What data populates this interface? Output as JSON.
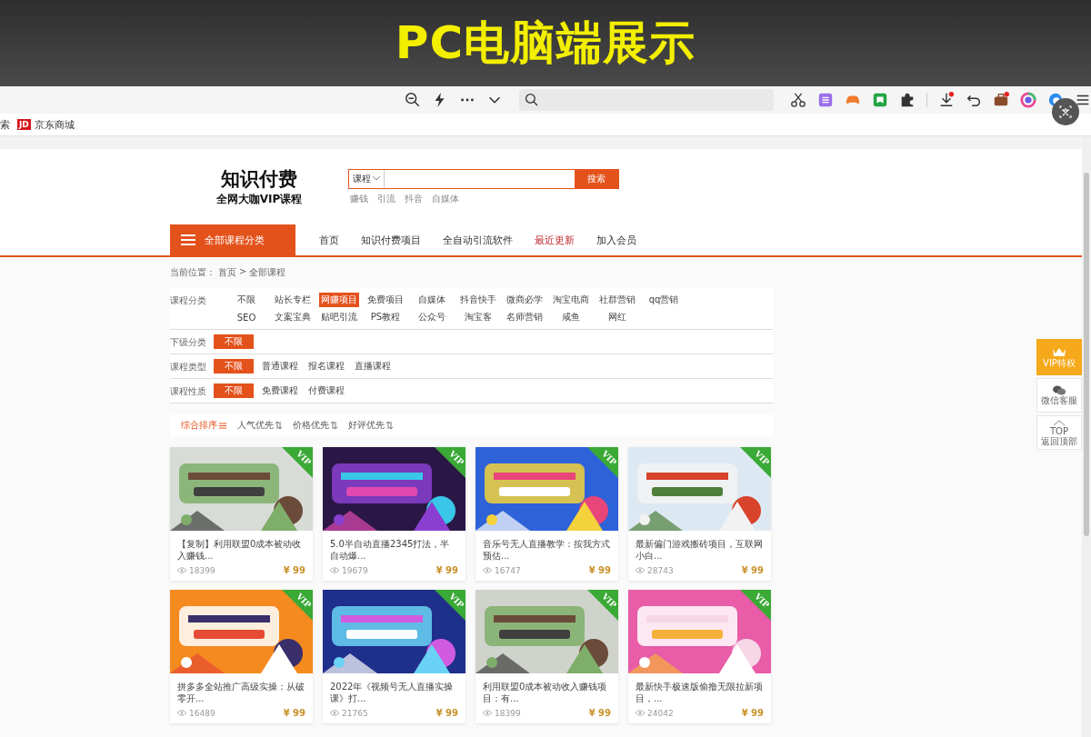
{
  "banner": {
    "title": "PC电脑端展示"
  },
  "bookmarks": [
    {
      "label": "索"
    },
    {
      "label": "京东商城",
      "logo": "JD"
    }
  ],
  "site": {
    "logo_title": "知识付费",
    "logo_subtitle": "全网大咖VIP课程",
    "search": {
      "scope": "课程",
      "button": "搜索",
      "hot_words": [
        "赚钱",
        "引流",
        "抖音",
        "自媒体"
      ]
    }
  },
  "nav": {
    "category_button": "全部课程分类",
    "items": [
      {
        "label": "首页",
        "highlight": false
      },
      {
        "label": "知识付费项目",
        "highlight": false
      },
      {
        "label": "全自动引流软件",
        "highlight": false
      },
      {
        "label": "最近更新",
        "highlight": true
      },
      {
        "label": "加入会员",
        "highlight": false
      }
    ]
  },
  "breadcrumb": {
    "prefix": "当前位置：",
    "items": [
      "首页",
      "全部课程"
    ],
    "separator": ">"
  },
  "filters": [
    {
      "label": "课程分类",
      "options": [
        {
          "label": "不限",
          "selected": false
        },
        {
          "label": "站长专栏",
          "selected": false
        },
        {
          "label": "网赚项目",
          "selected": true
        },
        {
          "label": "免费项目",
          "selected": false
        },
        {
          "label": "自媒体",
          "selected": false
        },
        {
          "label": "抖音快手",
          "selected": false
        },
        {
          "label": "微商必学",
          "selected": false
        },
        {
          "label": "淘宝电商",
          "selected": false
        },
        {
          "label": "社群营销",
          "selected": false
        },
        {
          "label": "qq营销",
          "selected": false
        },
        {
          "label": "SEO",
          "selected": false
        },
        {
          "label": "文案宝典",
          "selected": false
        },
        {
          "label": "贴吧引流",
          "selected": false
        },
        {
          "label": "PS教程",
          "selected": false
        },
        {
          "label": "公众号",
          "selected": false
        },
        {
          "label": "淘宝客",
          "selected": false
        },
        {
          "label": "名师营销",
          "selected": false
        },
        {
          "label": "咸鱼",
          "selected": false
        },
        {
          "label": "网红",
          "selected": false
        }
      ]
    },
    {
      "label": "下级分类",
      "options": [
        {
          "label": "不限",
          "selected": true
        }
      ]
    },
    {
      "label": "课程类型",
      "options": [
        {
          "label": "不限",
          "selected": true
        },
        {
          "label": "普通课程",
          "selected": false
        },
        {
          "label": "报名课程",
          "selected": false
        },
        {
          "label": "直播课程",
          "selected": false
        }
      ]
    },
    {
      "label": "课程性质",
      "options": [
        {
          "label": "不限",
          "selected": true
        },
        {
          "label": "免费课程",
          "selected": false
        },
        {
          "label": "付费课程",
          "selected": false
        }
      ]
    }
  ],
  "sort": [
    {
      "label": "综合排序",
      "selected": true,
      "kind": "lines"
    },
    {
      "label": "人气优先",
      "selected": false,
      "kind": "arrows"
    },
    {
      "label": "价格优先",
      "selected": false,
      "kind": "arrows"
    },
    {
      "label": "好评优先",
      "selected": false,
      "kind": "arrows"
    }
  ],
  "courses": [
    {
      "title": "【复制】利用联盟0成本被动收入赚钱...",
      "views": "18399",
      "price": "¥ 99",
      "badge": "VIP"
    },
    {
      "title": "5.0半自动直播2345打法，半自动爆...",
      "views": "19679",
      "price": "¥ 99",
      "badge": "VIP"
    },
    {
      "title": "音乐号无人直播教学：按我方式预估...",
      "views": "16747",
      "price": "¥ 99",
      "badge": "VIP"
    },
    {
      "title": "最新偏门游戏搬砖项目，互联网小白...",
      "views": "28743",
      "price": "¥ 99",
      "badge": "VIP"
    },
    {
      "title": "拼多多全站推广高级实操：从破零开...",
      "views": "16489",
      "price": "¥ 99",
      "badge": "VIP"
    },
    {
      "title": "2022年《视频号无人直播实操课》打...",
      "views": "21765",
      "price": "¥ 99",
      "badge": "VIP"
    },
    {
      "title": "利用联盟0成本被动收入赚钱项目：有...",
      "views": "18399",
      "price": "¥ 99",
      "badge": "VIP"
    },
    {
      "title": "最新快手极速版偷撸无限拉新项目，...",
      "views": "24042",
      "price": "¥ 99",
      "badge": "VIP"
    }
  ],
  "side_tools": [
    {
      "kind": "vip",
      "label": "VIP特权"
    },
    {
      "kind": "wechat",
      "label": "微信客服"
    },
    {
      "kind": "top",
      "top": "TOP",
      "label": "返回顶部"
    }
  ]
}
